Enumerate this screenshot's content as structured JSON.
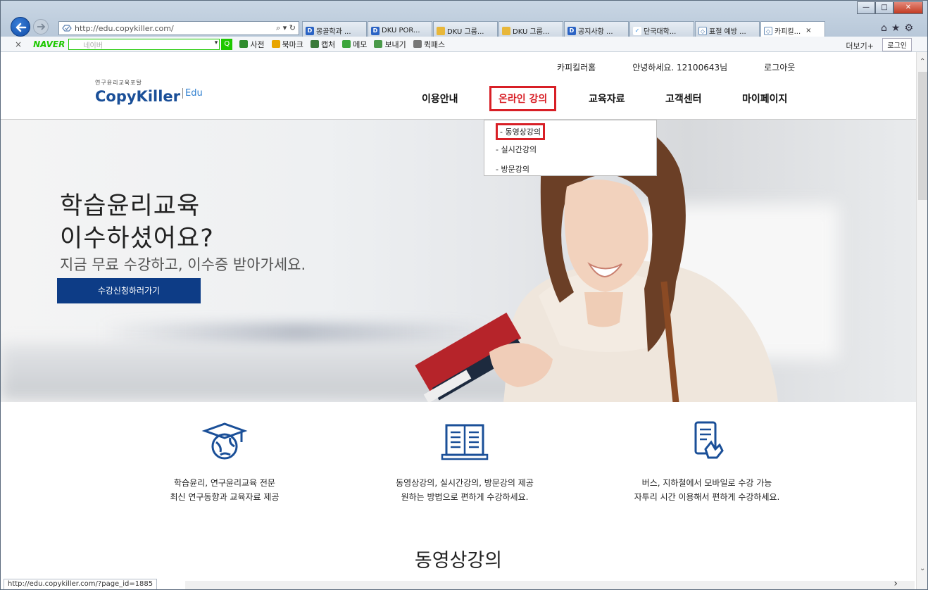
{
  "browser": {
    "address_url": "http://edu.copykiller.com/",
    "tabs": [
      {
        "label": "몽골학과 ...",
        "icon": "d"
      },
      {
        "label": "DKU POR...",
        "icon": "d"
      },
      {
        "label": "DKU 그룹...",
        "icon": "y"
      },
      {
        "label": "DKU 그룹...",
        "icon": "y"
      },
      {
        "label": "공지사항 ...",
        "icon": "d"
      },
      {
        "label": "단국대학...",
        "icon": "v"
      },
      {
        "label": "표절 예방 ...",
        "icon": "c"
      },
      {
        "label": "카피킬...",
        "icon": "c",
        "active": true
      }
    ],
    "status_url": "http://edu.copykiller.com/?page_id=1885"
  },
  "toolbar": {
    "close": "×",
    "naver": "NAVER",
    "search_placeholder": "네이버",
    "items": [
      {
        "label": "사전",
        "color": "#2e8b2e"
      },
      {
        "label": "북마크",
        "color": "#e8a400"
      },
      {
        "label": "캡처",
        "color": "#3a7a3a"
      },
      {
        "label": "메모",
        "color": "#3ba53b"
      },
      {
        "label": "보내기",
        "color": "#4a9a4a"
      },
      {
        "label": "퀵패스",
        "color": "#777777"
      }
    ],
    "more": "더보기+",
    "login": "로그인"
  },
  "site": {
    "util_links": [
      "카피킬러홈",
      "안녕하세요. 12100643님",
      "로그아웃"
    ],
    "logo_sub": "연구윤리교육포탈",
    "logo_main": "CopyKiller",
    "logo_edu": "Edu",
    "nav": [
      "이용안내",
      "온라인 강의",
      "교육자료",
      "고객센터",
      "마이페이지"
    ],
    "dropdown": [
      "동영상강의",
      "실시간강의",
      "방문강의"
    ],
    "hero": {
      "title_line1": "학습윤리교육",
      "title_line2": "이수하셨어요?",
      "subtitle": "지금 무료 수강하고, 이수증 받아가세요.",
      "button": "수강신청하러가기"
    },
    "features": [
      {
        "icon": "graduation-globe-icon",
        "line1": "학습윤리, 연구윤리교육 전문",
        "line2": "최신 연구동향과 교육자료 제공"
      },
      {
        "icon": "open-book-icon",
        "line1": "동영상강의, 실시간강의, 방문강의 제공",
        "line2": "원하는 방법으로 편하게 수강하세요."
      },
      {
        "icon": "mobile-touch-icon",
        "line1": "버스, 지하철에서 모바일로 수강 가능",
        "line2": "자투리 시간 이용해서 편하게 수강하세요."
      }
    ],
    "section_title": "동영상강의",
    "accent": "#d81f26",
    "brand": "#1a4f98",
    "button_color": "#0d3c86"
  }
}
